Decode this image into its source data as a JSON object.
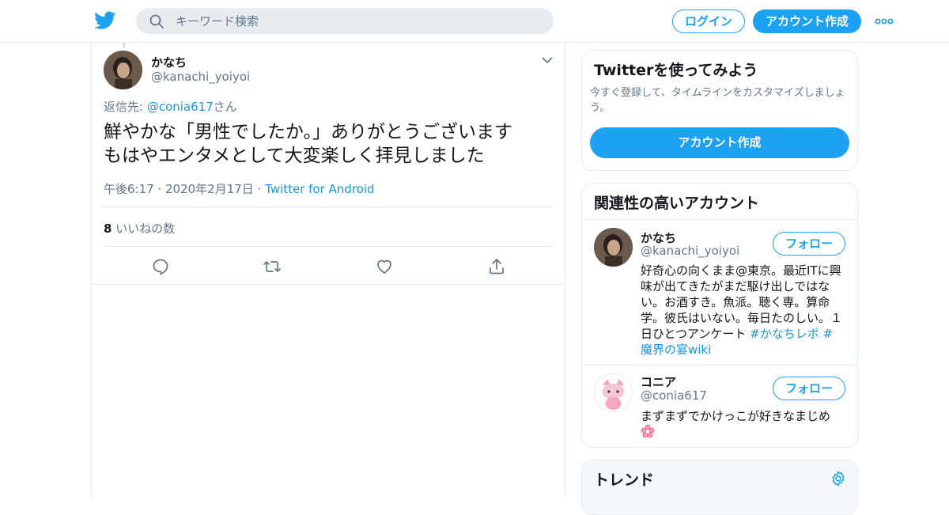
{
  "header": {
    "search_placeholder": "キーワード検索",
    "login_label": "ログイン",
    "signup_label": "アカウント作成",
    "icons": [
      "twitter-bird-icon",
      "search-icon",
      "more-icon"
    ]
  },
  "tweet": {
    "author_name": "かなち",
    "author_handle": "@kanachi_yoiyoi",
    "reply_prefix": "返信先: ",
    "reply_to": "@conia617",
    "reply_suffix": "さん",
    "text_line1": "鮮やかな「男性でしたか。」ありがとうございます",
    "text_line2": "もはやエンタメとして大変楽しく拝見しました",
    "timestamp": "午後6:17 · 2020年2月17日 · ",
    "source": "Twitter for Android",
    "like_count": "8",
    "like_label": " いいねの数",
    "action_icons": [
      "reply-icon",
      "retweet-icon",
      "like-icon",
      "share-icon"
    ]
  },
  "signup_card": {
    "title": "Twitterを使ってみよう",
    "description": "今すぐ登録して、タイムラインをカスタマイズしましょう。",
    "cta_label": "アカウント作成"
  },
  "related": {
    "title": "関連性の高いアカウント",
    "accounts": [
      {
        "name": "かなち",
        "handle": "@kanachi_yoiyoi",
        "follow_label": "フォロー",
        "bio_text": "好奇心の向くまま@東京。最近ITに興味が出てきたがまだ駆け出しではない。お酒すき。魚派。聴く専。算命学。彼氏はいない。毎日たのしい。１日ひとつアンケート ",
        "bio_link1": "#かなちレポ",
        "bio_link2": "#魔界の宴wiki"
      },
      {
        "name": "コニア",
        "handle": "@conia617",
        "follow_label": "フォロー",
        "bio_text": "まずまずでかけっこが好きなまじめ"
      }
    ]
  },
  "trends": {
    "title": "トレンド"
  },
  "colors": {
    "accent": "#1da1f2",
    "link": "#1b95e0",
    "muted": "#657786",
    "border": "#e6ecf0"
  }
}
